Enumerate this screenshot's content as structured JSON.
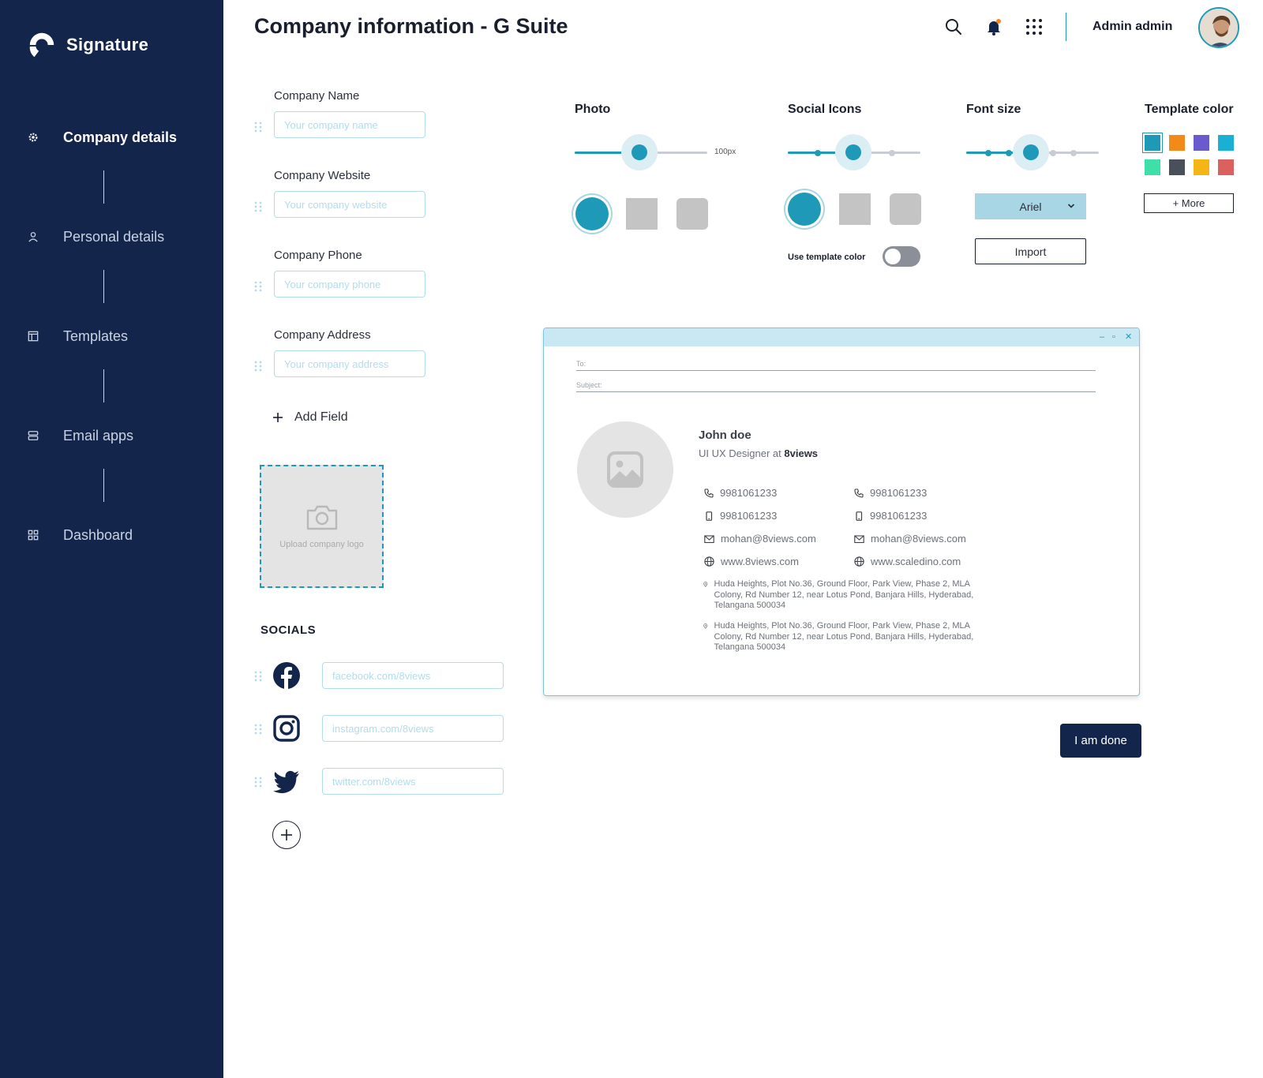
{
  "brand": {
    "name": "Signature"
  },
  "nav": {
    "items": [
      {
        "label": "Company details",
        "icon": "gear-icon",
        "active": true
      },
      {
        "label": "Personal details",
        "icon": "user-icon",
        "active": false
      },
      {
        "label": "Templates",
        "icon": "template-icon",
        "active": false
      },
      {
        "label": "Email apps",
        "icon": "stack-icon",
        "active": false
      },
      {
        "label": "Dashboard",
        "icon": "grid-icon",
        "active": false
      }
    ]
  },
  "header": {
    "title": "Company information - G Suite",
    "user_name": "Admin admin"
  },
  "form": {
    "fields": [
      {
        "label": "Company Name",
        "placeholder": "Your company name"
      },
      {
        "label": "Company Website",
        "placeholder": "Your company website"
      },
      {
        "label": "Company Phone",
        "placeholder": "Your company phone"
      },
      {
        "label": "Company Address",
        "placeholder": "Your company address"
      }
    ],
    "add_field_label": "Add Field",
    "upload_label": "Upload company logo"
  },
  "socials": {
    "title": "SOCIALS",
    "items": [
      {
        "network": "facebook",
        "placeholder": "facebook.com/8views"
      },
      {
        "network": "instagram",
        "placeholder": "instagram.com/8views"
      },
      {
        "network": "twitter",
        "placeholder": "twitter.com/8views"
      }
    ]
  },
  "controls": {
    "photo": {
      "title": "Photo",
      "value_label": "100px",
      "slider_fraction": 0.5
    },
    "social_icons": {
      "title": "Social Icons",
      "toggle_label": "Use template color",
      "toggle_on": false
    },
    "font_size": {
      "title": "Font size",
      "font": "Ariel",
      "import_label": "Import"
    },
    "template_color": {
      "title": "Template color",
      "more_label": "+ More",
      "swatches": [
        "#1e9ab8",
        "#f28a1a",
        "#6a5acd",
        "#1ab0d4",
        "#3ee0a8",
        "#4a4f5c",
        "#f5b514",
        "#d9625f"
      ]
    }
  },
  "preview": {
    "to_label": "To:",
    "subject_label": "Subject:",
    "name": "John doe",
    "role_prefix": "UI UX Designer at",
    "company": "8views",
    "left": {
      "phone": "9981061233",
      "mobile": "9981061233",
      "email": "mohan@8views.com",
      "web": "www.8views.com"
    },
    "right": {
      "phone": "9981061233",
      "mobile": "9981061233",
      "email": "mohan@8views.com",
      "web": "www.scaledino.com"
    },
    "addresses": [
      "Huda Heights, Plot No.36, Ground Floor, Park View, Phase 2, MLA Colony, Rd Number 12, near Lotus Pond, Banjara Hills, Hyderabad, Telangana 500034",
      "Huda Heights, Plot No.36, Ground Floor, Park View, Phase 2, MLA Colony, Rd Number 12, near Lotus Pond, Banjara Hills, Hyderabad, Telangana 500034"
    ]
  },
  "actions": {
    "done_label": "I am done"
  },
  "colors": {
    "sidebar": "#13254a",
    "accent": "#1e9ab8",
    "notification": "#f28a1a"
  }
}
